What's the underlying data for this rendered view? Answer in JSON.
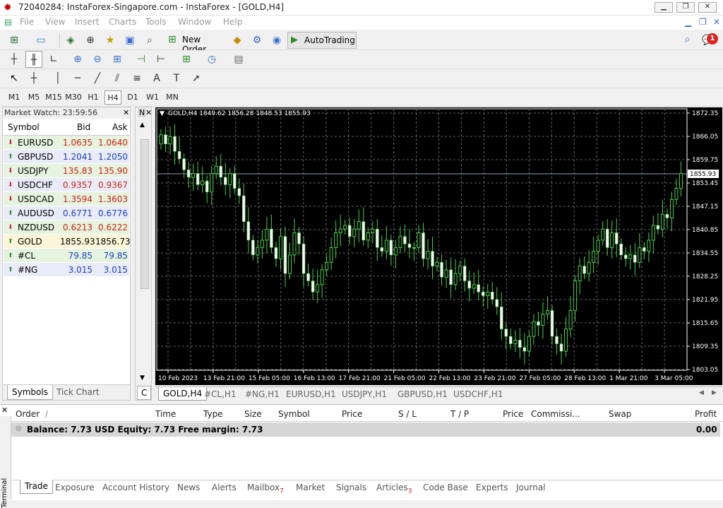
{
  "window": {
    "title": "72040284: InstaForex-Singapore.com - InstaForex - [GOLD,H4]"
  },
  "menu": [
    "File",
    "View",
    "Insert",
    "Charts",
    "Tools",
    "Window",
    "Help"
  ],
  "toolbar": {
    "new_order": "New Order",
    "autotrading": "AutoTrading",
    "notify_count": "1"
  },
  "timeframes": [
    "M1",
    "M5",
    "M15",
    "M30",
    "H1",
    "H4",
    "D1",
    "W1",
    "MN"
  ],
  "timeframe_selected": "H4",
  "market_watch": {
    "header": "Market Watch: 23:59:56",
    "columns": [
      "Symbol",
      "Bid",
      "Ask"
    ],
    "rows": [
      {
        "symbol": "EURUSD",
        "bid": "1.0635",
        "ask": "1.0640",
        "dir": "down"
      },
      {
        "symbol": "GBPUSD",
        "bid": "1.2041",
        "ask": "1.2050",
        "dir": "up"
      },
      {
        "symbol": "USDJPY",
        "bid": "135.83",
        "ask": "135.90",
        "dir": "down"
      },
      {
        "symbol": "USDCHF",
        "bid": "0.9357",
        "ask": "0.9367",
        "dir": "down"
      },
      {
        "symbol": "USDCAD",
        "bid": "1.3594",
        "ask": "1.3603",
        "dir": "down"
      },
      {
        "symbol": "AUDUSD",
        "bid": "0.6771",
        "ask": "0.6776",
        "dir": "up"
      },
      {
        "symbol": "NZDUSD",
        "bid": "0.6213",
        "ask": "0.6222",
        "dir": "down"
      },
      {
        "symbol": "GOLD",
        "bid": "1855.93",
        "ask": "1856.73",
        "dir": "up"
      },
      {
        "symbol": "#CL",
        "bid": "79.85",
        "ask": "79.85",
        "dir": "up"
      },
      {
        "symbol": "#NG",
        "bid": "3.015",
        "ask": "3.015",
        "dir": "up"
      }
    ],
    "tabs": [
      "Symbols",
      "Tick Chart"
    ]
  },
  "navigator": {
    "label": "N",
    "tab": "C"
  },
  "chart": {
    "info": "GOLD,H4  1849.62 1856.28 1848.53 1855.93",
    "price_ticks": [
      "1872.35",
      "1866.05",
      "1859.75",
      "1853.45",
      "1847.15",
      "1840.85",
      "1834.55",
      "1828.25",
      "1821.95",
      "1815.65",
      "1809.35",
      "1803.05"
    ],
    "current_price": "1855.93",
    "date_ticks": [
      "10 Feb 2023",
      "13 Feb 21:00",
      "15 Feb 05:00",
      "16 Feb 13:00",
      "17 Feb 21:00",
      "21 Feb 05:00",
      "22 Feb 13:00",
      "23 Feb 21:00",
      "27 Feb 05:00",
      "28 Feb 13:00",
      "1 Mar 21:00",
      "3 Mar 05:00"
    ]
  },
  "chart_tabs": [
    "GOLD,H4",
    "#CL,H1",
    "#NG,H1",
    "EURUSD,H1",
    "USDJPY,H1",
    "GBPUSD,H1",
    "USDCHF,H1"
  ],
  "terminal": {
    "columns": [
      "Order",
      "/",
      "Time",
      "Type",
      "Size",
      "Symbol",
      "Price",
      "S / L",
      "T / P",
      "Price",
      "Commissi...",
      "Swap",
      "Profit"
    ],
    "balance_line": "Balance: 7.73 USD  Equity: 7.73  Free margin: 7.73",
    "profit": "0.00",
    "side_label": "Terminal",
    "tabs": [
      "Trade",
      "Exposure",
      "Account History",
      "News",
      "Alerts",
      "Mailbox",
      "Market",
      "Signals",
      "Articles",
      "Code Base",
      "Experts",
      "Journal"
    ],
    "mailbox_count": "7",
    "articles_count": "3"
  }
}
